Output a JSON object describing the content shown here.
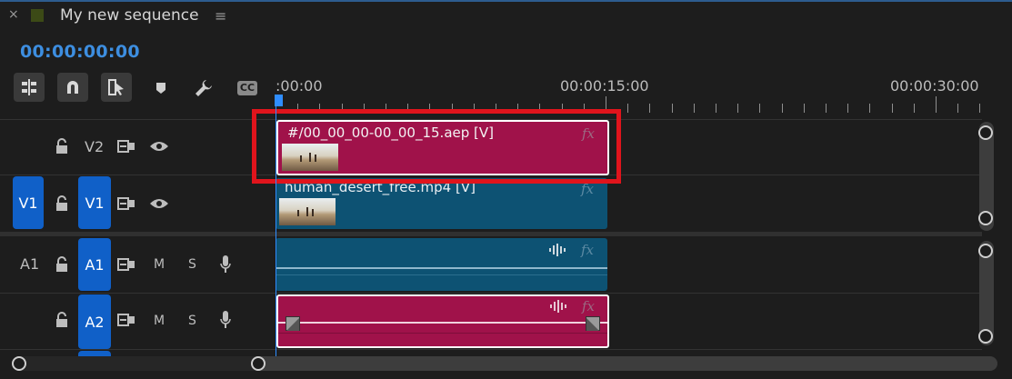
{
  "tab": {
    "close_glyph": "×",
    "title": "My new sequence",
    "menu_glyph": "≡",
    "label_color": "#3c4a16"
  },
  "timecode": "00:00:00:00",
  "toolbar": {
    "icons": [
      "insert-edit-icon",
      "snap-magnet-icon",
      "linked-selection-icon",
      "add-marker-icon",
      "wrench-settings-icon",
      "captions-icon"
    ],
    "captions_label": "CC"
  },
  "ruler": {
    "labels": [
      ":00:00",
      "00:00:15:00",
      "00:00:30:00"
    ]
  },
  "tracks": {
    "v2": {
      "label": "V2"
    },
    "v1": {
      "source_label": "V1",
      "label": "V1"
    },
    "a1": {
      "source_label": "A1",
      "label": "A1",
      "mute": "M",
      "solo": "S"
    },
    "a2": {
      "label": "A2",
      "mute": "M",
      "solo": "S"
    }
  },
  "clips": {
    "v2_clip": {
      "name": "#/00_00_00-00_00_15.aep [V]",
      "fx": "fx",
      "color": "#a0124a"
    },
    "v1_clip": {
      "name": "human_desert_free.mp4 [V]",
      "fx": "fx",
      "color": "#0d5273"
    },
    "a1_clip": {
      "fx": "fx",
      "color": "#0d5273"
    },
    "a2_clip": {
      "fx": "fx",
      "color": "#a0124a"
    }
  },
  "colors": {
    "accent": "#2f8dff",
    "track_target": "#1060c8",
    "highlight": "#e0141c"
  }
}
